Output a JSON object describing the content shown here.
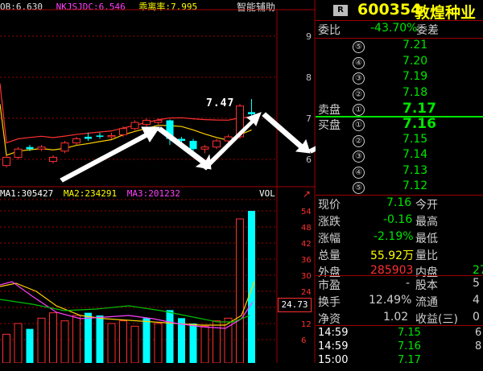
{
  "chart_header": {
    "ind1": "OB:6.630",
    "ind2": "NKJSJDC:6.546",
    "ind3": "乖离率:7.995",
    "assist": "智能辅助"
  },
  "price_axis": [
    "9",
    "8",
    "7",
    "6"
  ],
  "price_annotation": "7.47",
  "volume_header": {
    "ma1": "MA1:305427",
    "ma2": "MA2:234291",
    "ma3": "MA3:201232",
    "vol": "VOL"
  },
  "vol_axis": [
    "54",
    "48",
    "42",
    "36",
    "30",
    "24",
    "18",
    "12",
    "6"
  ],
  "vol_marker": "24.73",
  "stock": {
    "badge": "R",
    "code": "600354",
    "name": "敦煌种业"
  },
  "weibi": {
    "label": "委比",
    "value": "-43.70%",
    "label2": "委差"
  },
  "asks": [
    {
      "level": "⑤",
      "price": "7.21"
    },
    {
      "level": "④",
      "price": "7.20"
    },
    {
      "level": "③",
      "price": "7.19"
    },
    {
      "level": "②",
      "price": "7.18"
    },
    {
      "level": "①",
      "price": "7.17",
      "label": "卖盘"
    }
  ],
  "bids": [
    {
      "level": "①",
      "price": "7.16",
      "label": "买盘"
    },
    {
      "level": "②",
      "price": "7.15"
    },
    {
      "level": "③",
      "price": "7.14"
    },
    {
      "level": "④",
      "price": "7.13"
    },
    {
      "level": "⑤",
      "price": "7.12"
    }
  ],
  "quote": {
    "xianjia": {
      "label": "现价",
      "value": "7.16",
      "label2": "今开"
    },
    "zhangdie": {
      "label": "涨跌",
      "value": "-0.16",
      "label2": "最高"
    },
    "zhangfu": {
      "label": "涨幅",
      "value": "-2.19%",
      "label2": "最低"
    },
    "zongliang": {
      "label": "总量",
      "value": "55.92万",
      "label2": "量比"
    },
    "waipan": {
      "label": "外盘",
      "value": "285903",
      "label2": "内盘",
      "value2": "27"
    }
  },
  "fundamentals": {
    "shiying": {
      "label": "市盈",
      "value": "-",
      "label2": "股本",
      "value2": "5"
    },
    "huanshou": {
      "label": "换手",
      "value": "12.49%",
      "label2": "流通",
      "value2": "4"
    },
    "jingzi": {
      "label": "净资",
      "value": "1.02",
      "label2": "收益(三)",
      "value2": "0"
    }
  },
  "ticks": [
    {
      "time": "14:59",
      "price": "7.15",
      "extra": "6"
    },
    {
      "time": "14:59",
      "price": "7.16",
      "extra": "8"
    },
    {
      "time": "15:00",
      "price": "7.17",
      "extra": ""
    }
  ],
  "chart_data": {
    "type": "candlestick",
    "price_ticks": [
      9,
      8,
      7,
      6
    ],
    "annotation_price": 7.47,
    "candles": [
      {
        "o": 5.85,
        "c": 6.05,
        "h": 6.1,
        "l": 5.8,
        "up": true
      },
      {
        "o": 6.05,
        "c": 6.25,
        "h": 6.3,
        "l": 6.0,
        "up": true
      },
      {
        "o": 6.3,
        "c": 6.25,
        "h": 6.35,
        "l": 6.2,
        "up": false
      },
      {
        "o": 6.25,
        "c": 6.3,
        "h": 6.35,
        "l": 6.2,
        "up": true
      },
      {
        "o": 5.95,
        "c": 6.05,
        "h": 6.1,
        "l": 5.9,
        "up": true
      },
      {
        "o": 6.2,
        "c": 6.4,
        "h": 6.45,
        "l": 6.15,
        "up": true
      },
      {
        "o": 6.4,
        "c": 6.5,
        "h": 6.55,
        "l": 6.35,
        "up": true
      },
      {
        "o": 6.55,
        "c": 6.5,
        "h": 6.65,
        "l": 6.45,
        "up": false
      },
      {
        "o": 6.58,
        "c": 6.55,
        "h": 6.65,
        "l": 6.5,
        "up": false
      },
      {
        "o": 6.55,
        "c": 6.58,
        "h": 6.65,
        "l": 6.5,
        "up": true
      },
      {
        "o": 6.6,
        "c": 6.75,
        "h": 6.8,
        "l": 6.55,
        "up": true
      },
      {
        "o": 6.75,
        "c": 6.9,
        "h": 6.95,
        "l": 6.7,
        "up": true
      },
      {
        "o": 6.85,
        "c": 6.95,
        "h": 7.0,
        "l": 6.8,
        "up": true
      },
      {
        "o": 6.9,
        "c": 6.95,
        "h": 7.0,
        "l": 6.85,
        "up": true
      },
      {
        "o": 6.95,
        "c": 6.5,
        "h": 6.97,
        "l": 6.35,
        "up": false
      },
      {
        "o": 6.5,
        "c": 6.45,
        "h": 6.55,
        "l": 6.4,
        "up": false
      },
      {
        "o": 6.45,
        "c": 6.25,
        "h": 6.5,
        "l": 6.2,
        "up": false
      },
      {
        "o": 6.25,
        "c": 6.3,
        "h": 6.35,
        "l": 6.15,
        "up": true
      },
      {
        "o": 6.3,
        "c": 6.45,
        "h": 6.5,
        "l": 6.25,
        "up": true
      },
      {
        "o": 6.45,
        "c": 6.55,
        "h": 6.6,
        "l": 6.4,
        "up": true
      },
      {
        "o": 6.55,
        "c": 7.3,
        "h": 7.35,
        "l": 6.5,
        "up": true
      },
      {
        "o": 7.1,
        "c": 7.15,
        "h": 7.47,
        "l": 7.05,
        "up": false
      }
    ],
    "vol_ticks": [
      54,
      48,
      42,
      36,
      30,
      24,
      18,
      12,
      6
    ],
    "volumes": [
      {
        "v": 8,
        "up": true
      },
      {
        "v": 12,
        "up": true
      },
      {
        "v": 10,
        "up": false
      },
      {
        "v": 14,
        "up": true
      },
      {
        "v": 16,
        "up": true
      },
      {
        "v": 13,
        "up": true
      },
      {
        "v": 15,
        "up": true
      },
      {
        "v": 16,
        "up": false
      },
      {
        "v": 15,
        "up": false
      },
      {
        "v": 12,
        "up": true
      },
      {
        "v": 13,
        "up": true
      },
      {
        "v": 11,
        "up": true
      },
      {
        "v": 14,
        "up": false
      },
      {
        "v": 12,
        "up": true
      },
      {
        "v": 17,
        "up": false
      },
      {
        "v": 14,
        "up": false
      },
      {
        "v": 12,
        "up": false
      },
      {
        "v": 11,
        "up": true
      },
      {
        "v": 13,
        "up": true
      },
      {
        "v": 14,
        "up": true
      },
      {
        "v": 51,
        "up": true
      },
      {
        "v": 54,
        "up": false
      }
    ]
  },
  "colors": {
    "up": "#ff3030",
    "down": "#00ffff",
    "grid": "#a00000",
    "ma_yellow": "#ffd000",
    "ma_pink": "#ff40ff",
    "ma_green": "#00c000"
  }
}
